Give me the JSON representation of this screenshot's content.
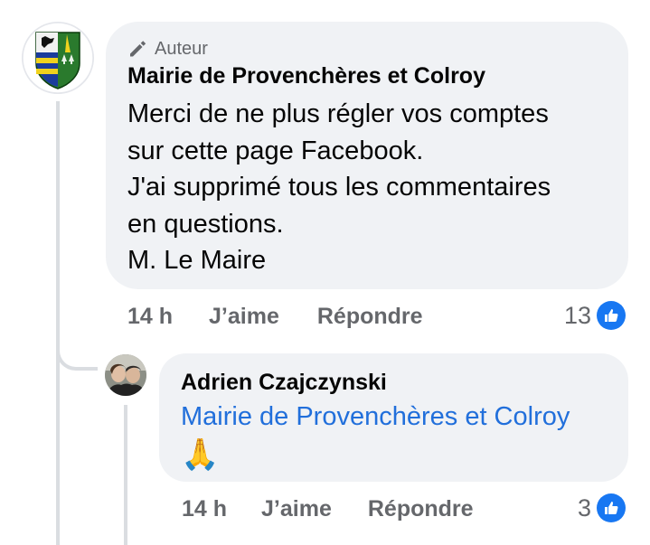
{
  "comment": {
    "author_badge": "Auteur",
    "author_name": "Mairie de Provenchères et Colroy",
    "text_lines": [
      "Merci de ne plus régler vos comptes",
      "sur cette page Facebook.",
      "J'ai supprimé tous les commentaires",
      "en questions.",
      "M. Le Maire"
    ],
    "time": "14 h",
    "like_label": "J’aime",
    "reply_label": "Répondre",
    "reaction_count": "13"
  },
  "reply": {
    "author_name": "Adrien Czajczynski",
    "mention": "Mairie de Provenchères et Colroy",
    "emoji": "🙏",
    "time": "14 h",
    "like_label": "J’aime",
    "reply_label": "Répondre",
    "reaction_count": "3"
  },
  "colors": {
    "bubble": "#f0f2f5",
    "mention": "#216fdb",
    "like_badge": "#1877f2",
    "muted_text": "#65676b"
  },
  "icons": {
    "author_badge": "pencil-icon",
    "reaction": "thumbs-up-icon",
    "page_avatar": "coat-of-arms-icon",
    "user_avatar": "profile-photo"
  }
}
